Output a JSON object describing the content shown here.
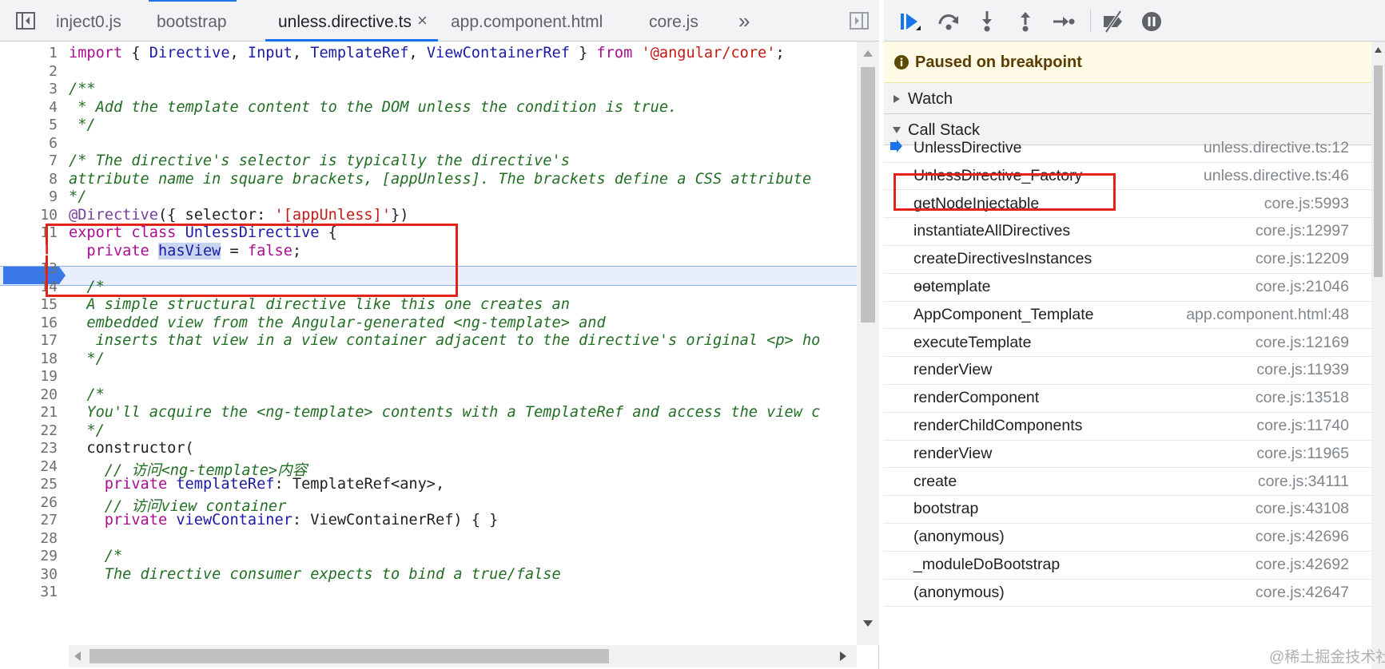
{
  "editor": {
    "tabs": [
      {
        "label": "inject0.js",
        "active": false
      },
      {
        "label": "bootstrap",
        "active": false
      },
      {
        "label": "unless.directive.ts",
        "active": true
      },
      {
        "label": "app.component.html",
        "active": false
      },
      {
        "label": "core.js",
        "active": false
      }
    ],
    "close_glyph": "×",
    "more_glyph": "»",
    "breakpoint_line": 12,
    "lines": [
      {
        "n": "1"
      },
      {
        "n": "2"
      },
      {
        "n": "3"
      },
      {
        "n": "4"
      },
      {
        "n": "5"
      },
      {
        "n": "6"
      },
      {
        "n": "7"
      },
      {
        "n": "8"
      },
      {
        "n": "9"
      },
      {
        "n": "10"
      },
      {
        "n": "11"
      },
      {
        "n": "12"
      },
      {
        "n": "13"
      },
      {
        "n": "14"
      },
      {
        "n": "15"
      },
      {
        "n": "16"
      },
      {
        "n": "17"
      },
      {
        "n": "18"
      },
      {
        "n": "19"
      },
      {
        "n": "20"
      },
      {
        "n": "21"
      },
      {
        "n": "22"
      },
      {
        "n": "23"
      },
      {
        "n": "24"
      },
      {
        "n": "25"
      },
      {
        "n": "26"
      },
      {
        "n": "27"
      },
      {
        "n": "28"
      },
      {
        "n": "29"
      },
      {
        "n": "30"
      },
      {
        "n": "31"
      }
    ],
    "code": {
      "l1": {
        "kw1": "import",
        "p1": " { ",
        "c1": "Directive",
        "p2": ", ",
        "c2": "Input",
        "p3": ", ",
        "c3": "TemplateRef",
        "p4": ", ",
        "c4": "ViewContainerRef",
        "p5": " } ",
        "kw2": "from",
        "p6": " ",
        "s1": "'@angular/core'",
        "p7": ";"
      },
      "l3": "/**",
      "l4": " * Add the template content to the DOM unless the condition is true.",
      "l5": " */",
      "l7": "/* The directive's selector is typically the directive's",
      "l8": "attribute name in square brackets, [appUnless]. The brackets define a CSS attribute",
      "l9": "*/",
      "l10": {
        "a": "@Directive",
        "b": "({ selector: ",
        "s": "'[appUnless]'",
        "c": "})"
      },
      "l11": {
        "kw1": "export",
        "p1": " ",
        "kw2": "class",
        "p2": " ",
        "cls": "UnlessDirective",
        "p3": " {"
      },
      "l12": {
        "indent": "  ",
        "kw1": "private",
        "p1": " ",
        "var": "hasView",
        "p2": " = ",
        "kw2": "false",
        "p3": ";"
      },
      "l14": "  /*",
      "l15": "  A simple structural directive like this one creates an",
      "l16": "  embedded view from the Angular-generated <ng-template> and",
      "l17": "   inserts that view in a view container adjacent to the directive's original <p> ho",
      "l18": "  */",
      "l20": "  /*",
      "l21": "  You'll acquire the <ng-template> contents with a TemplateRef and access the view c",
      "l22": "  */",
      "l23": "  constructor(",
      "l24": {
        "a": "    // ",
        "b": "访问",
        "c": "<ng-template>",
        "d": "内容"
      },
      "l25": {
        "indent": "    ",
        "kw": "private",
        "p1": " ",
        "var": "templateRef",
        "p2": ": TemplateRef<any>,"
      },
      "l26": {
        "a": "    // ",
        "b": "访问",
        "c": "view container"
      },
      "l27": {
        "indent": "    ",
        "kw": "private",
        "p1": " ",
        "var": "viewContainer",
        "p2": ": ViewContainerRef) { }"
      },
      "l29": "    /*",
      "l30": "    The directive consumer expects to bind a true/false"
    }
  },
  "debugger": {
    "toolbar_icons": [
      "resume-icon",
      "step-over-icon",
      "step-into-icon",
      "step-out-icon",
      "step-icon",
      "deactivate-breakpoints-icon",
      "pause-on-exceptions-icon"
    ],
    "paused_message": "Paused on breakpoint",
    "watch_label": "Watch",
    "call_stack_label": "Call Stack",
    "call_stack": [
      {
        "name": "UnlessDirective",
        "location": "unless.directive.ts:12",
        "current": true
      },
      {
        "name": "UnlessDirective_Factory",
        "location": "unless.directive.ts:46"
      },
      {
        "name": "getNodeInjectable",
        "location": "core.js:5993"
      },
      {
        "name": "instantiateAllDirectives",
        "location": "core.js:12997"
      },
      {
        "name": "createDirectivesInstances",
        "location": "core.js:12209"
      },
      {
        "name": "ɵɵtemplate",
        "location": "core.js:21046"
      },
      {
        "name": "AppComponent_Template",
        "location": "app.component.html:48"
      },
      {
        "name": "executeTemplate",
        "location": "core.js:12169"
      },
      {
        "name": "renderView",
        "location": "core.js:11939"
      },
      {
        "name": "renderComponent",
        "location": "core.js:13518"
      },
      {
        "name": "renderChildComponents",
        "location": "core.js:11740"
      },
      {
        "name": "renderView",
        "location": "core.js:11965"
      },
      {
        "name": "create",
        "location": "core.js:34111"
      },
      {
        "name": "bootstrap",
        "location": "core.js:43108"
      },
      {
        "name": "(anonymous)",
        "location": "core.js:42696"
      },
      {
        "name": "_moduleDoBootstrap",
        "location": "core.js:42692"
      },
      {
        "name": "(anonymous)",
        "location": "core.js:42647"
      }
    ],
    "watermark": "@稀土掘金技术社区"
  },
  "colors": {
    "accent": "#1a73e8",
    "highlight_box": "#e2231a",
    "paused_bg": "#fffbe6"
  }
}
